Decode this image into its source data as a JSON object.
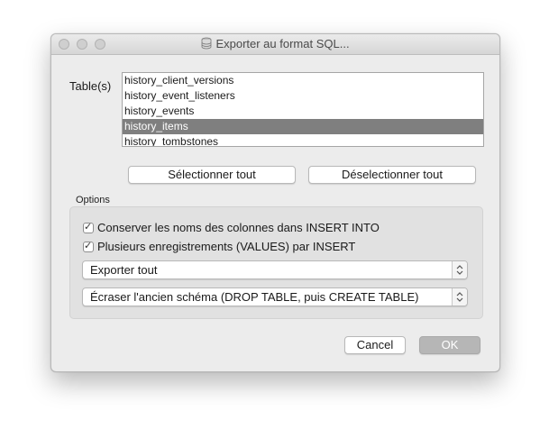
{
  "window": {
    "title": "Exporter au format SQL...",
    "title_icon": "database-icon"
  },
  "tables": {
    "label": "Table(s)",
    "items": [
      {
        "label": "history_client_versions",
        "selected": false
      },
      {
        "label": "history_event_listeners",
        "selected": false
      },
      {
        "label": "history_events",
        "selected": false
      },
      {
        "label": "history_items",
        "selected": true
      },
      {
        "label": "history_tombstones",
        "selected": false
      }
    ]
  },
  "buttons": {
    "select_all": "Sélectionner tout",
    "deselect_all": "Déselectionner tout",
    "cancel": "Cancel",
    "ok": "OK"
  },
  "options": {
    "label": "Options",
    "keep_column_names": {
      "label": "Conserver les noms des colonnes dans INSERT INTO",
      "checked": true
    },
    "multiple_records": {
      "label": "Plusieurs enregistrements (VALUES) par INSERT",
      "checked": true
    },
    "export_select": {
      "value": "Exporter tout"
    },
    "schema_select": {
      "value": "Écraser l'ancien schéma (DROP TABLE, puis CREATE TABLE)"
    }
  }
}
